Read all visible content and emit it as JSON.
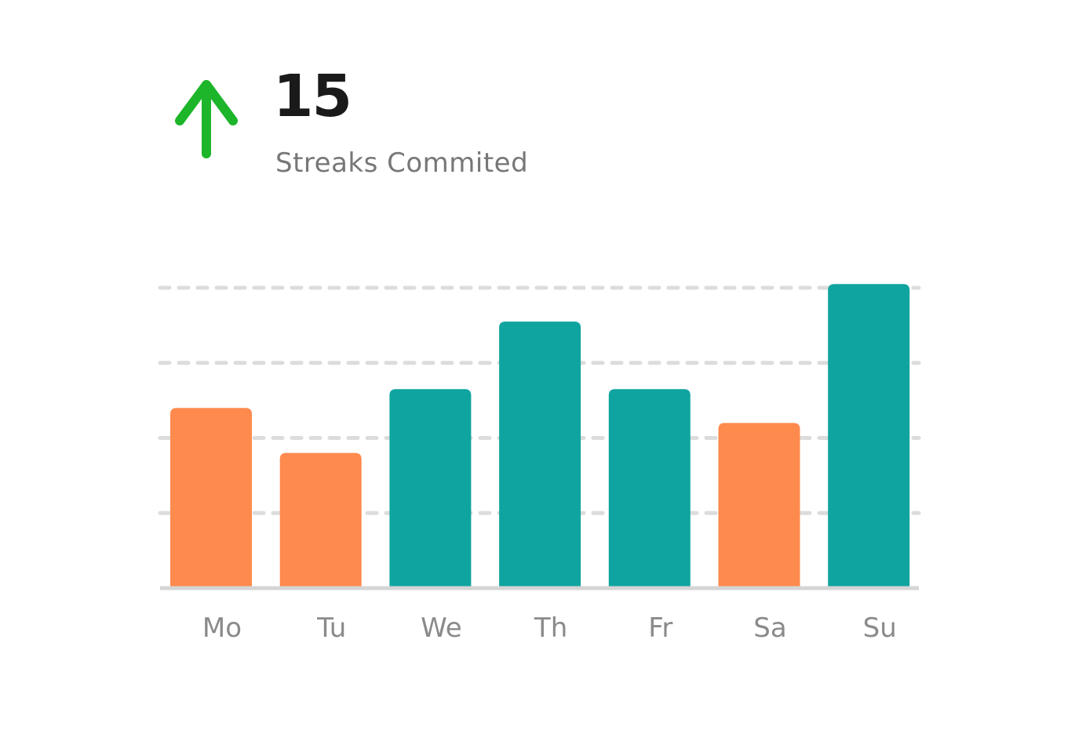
{
  "stat": {
    "value": "15",
    "label": "Streaks Commited",
    "trend_icon": "arrow-up-icon",
    "trend_color": "#1db52a"
  },
  "chart_data": {
    "type": "bar",
    "categories": [
      "Mo",
      "Tu",
      "We",
      "Th",
      "Fr",
      "Sa",
      "Su"
    ],
    "values": [
      2.4,
      1.8,
      2.65,
      3.55,
      2.65,
      2.2,
      4.05
    ],
    "bar_colors": [
      "#ff8a4d",
      "#ff8a4d",
      "#0fa4a0",
      "#0fa4a0",
      "#0fa4a0",
      "#ff8a4d",
      "#0fa4a0"
    ],
    "ylim": [
      0,
      4
    ],
    "gridlines": [
      1,
      2,
      3,
      4
    ],
    "grid": true,
    "grid_style": "dashed",
    "grid_color": "#dcdcdc",
    "axis_color": "#d5d5d5",
    "title": "",
    "xlabel": "",
    "ylabel": ""
  }
}
